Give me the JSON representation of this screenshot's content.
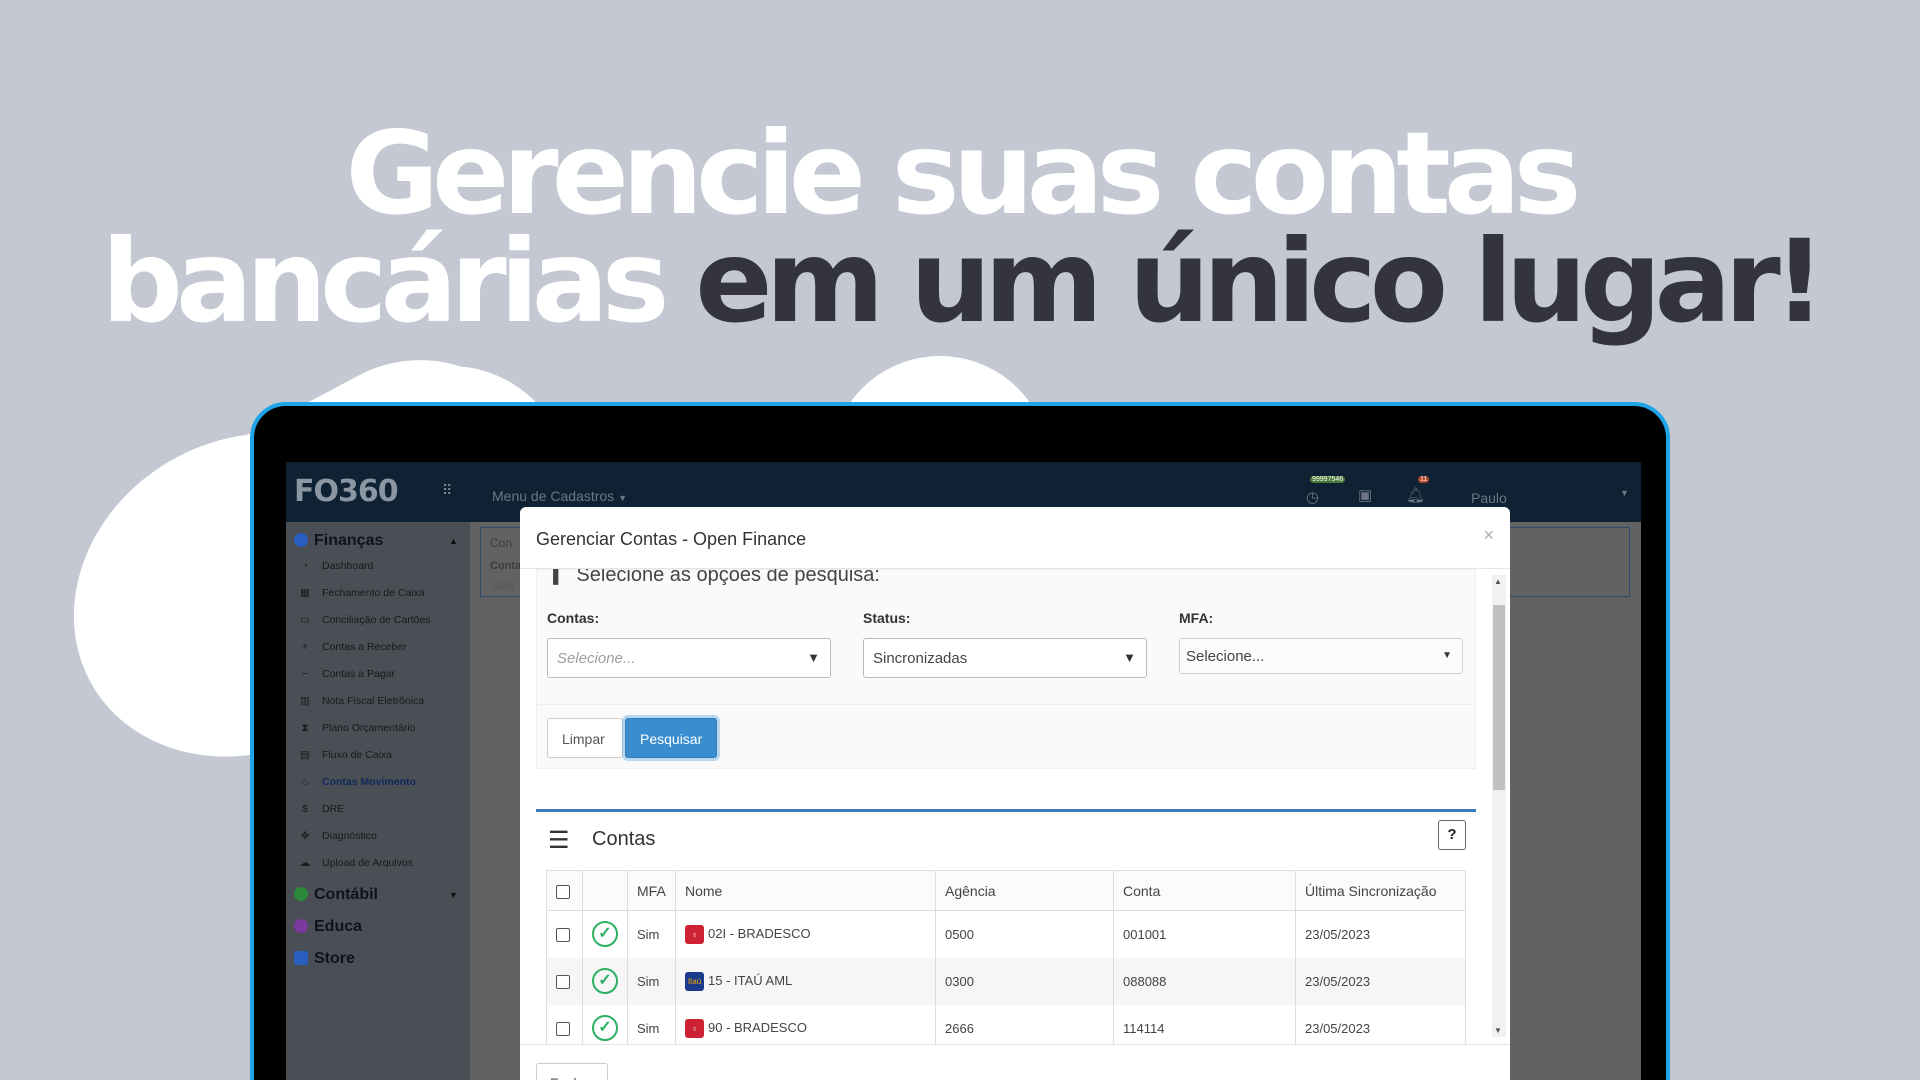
{
  "headline": {
    "line1": "Gerencie suas contas",
    "line2_light": "bancárias",
    "line2_dark": "em um único lugar!"
  },
  "app": {
    "logo": "FO360",
    "menu_cadastros": "Menu de Cadastros",
    "counter_badge": "99997546",
    "notif_count": "11",
    "user": "Paulo"
  },
  "sidebar": {
    "financas": "Finanças",
    "items": [
      {
        "label": "Dashboard",
        "icon": "speedometer-icon"
      },
      {
        "label": "Fechamento de Caixa",
        "icon": "calendar-icon"
      },
      {
        "label": "Conciliação de Cartões",
        "icon": "card-icon"
      },
      {
        "label": "Contas a Receber",
        "icon": "plus-icon"
      },
      {
        "label": "Contas a Pagar",
        "icon": "minus-icon"
      },
      {
        "label": "Nota Fiscal Eletrônica",
        "icon": "barcode-icon"
      },
      {
        "label": "Plano Orçamentário",
        "icon": "hourglass-icon"
      },
      {
        "label": "Fluxo de Caixa",
        "icon": "printer-icon"
      },
      {
        "label": "Contas Movimento",
        "icon": "bank-icon"
      },
      {
        "label": "DRE",
        "icon": "dollar-icon"
      },
      {
        "label": "Diagnóstico",
        "icon": "handshake-icon"
      },
      {
        "label": "Upload de Arquivos",
        "icon": "cloud-upload-icon"
      }
    ],
    "contabil": "Contábil",
    "educa": "Educa",
    "store": "Store"
  },
  "background": {
    "tab": "Con",
    "label": "Conta",
    "input": "Sele"
  },
  "modal": {
    "title": "Gerenciar Contas - Open Finance",
    "close": "×",
    "search_heading": "Selecione as opções de pesquisa:",
    "fields": {
      "contas_label": "Contas:",
      "contas_placeholder": "Selecione...",
      "status_label": "Status:",
      "status_value": "Sincronizadas",
      "mfa_label": "MFA:",
      "mfa_value": "Selecione..."
    },
    "buttons": {
      "clear": "Limpar",
      "search": "Pesquisar",
      "close": "Fechar"
    },
    "table_title": "Contas",
    "help": "?",
    "columns": [
      "MFA",
      "Nome",
      "Agência",
      "Conta",
      "Última Sincronização"
    ],
    "rows": [
      {
        "mfa": "Sim",
        "nome": "02I - BRADESCO",
        "bank": "bradesco",
        "agencia": "0500",
        "conta": "001001",
        "sync": "23/05/2023"
      },
      {
        "mfa": "Sim",
        "nome": "15 - ITAÚ AML",
        "bank": "itau",
        "agencia": "0300",
        "conta": "088088",
        "sync": "23/05/2023"
      },
      {
        "mfa": "Sim",
        "nome": "90 - BRADESCO",
        "bank": "bradesco",
        "agencia": "2666",
        "conta": "114114",
        "sync": "23/05/2023"
      }
    ],
    "itau_logo_text": "Itaú"
  },
  "colors": {
    "background": "#c4c8d3",
    "laptop_border": "#1ea5e8",
    "primary_button": "#3a8ed0",
    "success": "#2db063",
    "bradesco": "#cc2233",
    "itau": "#1b3a8c"
  }
}
